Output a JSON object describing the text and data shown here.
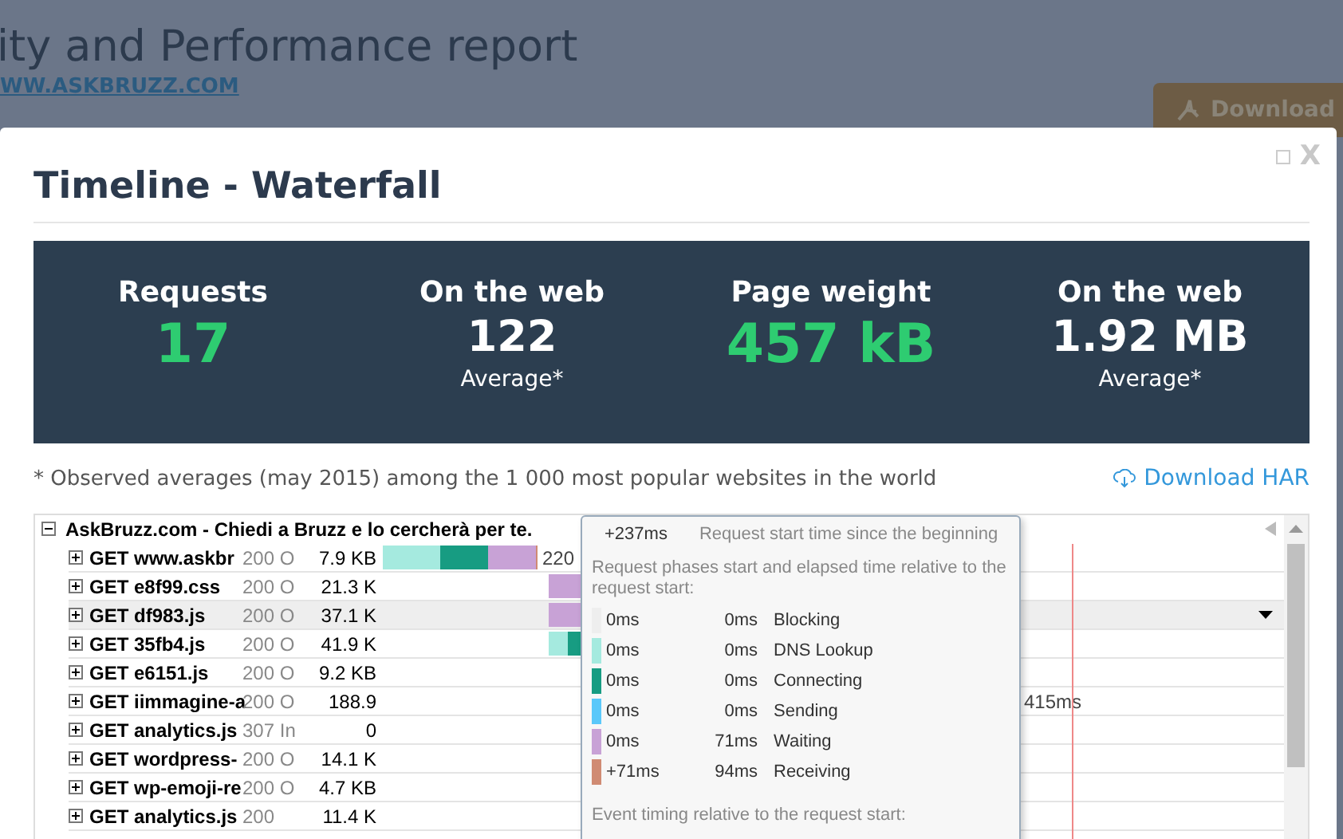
{
  "page": {
    "title": "ity and Performance report",
    "link": "WW.ASKBRUZZ.COM",
    "download_button": "Download"
  },
  "modal": {
    "title": "Timeline - Waterfall",
    "close": "X"
  },
  "stats": [
    {
      "label": "Requests",
      "value": "17",
      "highlight": true
    },
    {
      "label": "On the web",
      "value": "122",
      "note": "Average*",
      "highlight": false
    },
    {
      "label": "Page weight",
      "value": "457 kB",
      "highlight": true
    },
    {
      "label": "On the web",
      "value": "1.92 MB",
      "note": "Average*",
      "highlight": false
    }
  ],
  "footnote": "* Observed averages (may 2015) among the 1 000 most popular websites in the world",
  "download_har": "Download HAR",
  "waterfall": {
    "page": "AskBruzz.com - Chiedi a Bruzz e lo cercherà per te.",
    "expanded": true,
    "rows": [
      {
        "name": "GET www.askbr",
        "status": "200 O",
        "size": "7.9 KB",
        "timing": "220",
        "selected": false
      },
      {
        "name": "GET e8f99.css",
        "status": "200 O",
        "size": "21.3 K",
        "selected": false
      },
      {
        "name": "GET df983.js",
        "status": "200 O",
        "size": "37.1 K",
        "selected": true
      },
      {
        "name": "GET 35fb4.js",
        "status": "200 O",
        "size": "41.9 K",
        "selected": false
      },
      {
        "name": "GET e6151.js",
        "status": "200 O",
        "size": "9.2 KB",
        "selected": false
      },
      {
        "name": "GET iimmagine-a",
        "status": "200 O",
        "size": "188.9",
        "timing": "415ms",
        "selected": false
      },
      {
        "name": "GET analytics.js",
        "status": "307 In",
        "size": "0",
        "selected": false
      },
      {
        "name": "GET wordpress-",
        "status": "200 O",
        "size": "14.1 K",
        "selected": false
      },
      {
        "name": "GET wp-emoji-re",
        "status": "200 O",
        "size": "4.7 KB",
        "selected": false
      },
      {
        "name": "GET analytics.js",
        "status": "200",
        "size": "11.4 K",
        "selected": false
      }
    ]
  },
  "tooltip": {
    "start": "+237ms",
    "start_label": "Request start time since the beginning",
    "phases_heading": "Request phases start and elapsed time relative to the request start:",
    "phases": [
      {
        "start": "0ms",
        "elapsed": "0ms",
        "name": "Blocking",
        "color": "#eeeeee"
      },
      {
        "start": "0ms",
        "elapsed": "0ms",
        "name": "DNS Lookup",
        "color": "#a5eadf"
      },
      {
        "start": "0ms",
        "elapsed": "0ms",
        "name": "Connecting",
        "color": "#179c82"
      },
      {
        "start": "0ms",
        "elapsed": "0ms",
        "name": "Sending",
        "color": "#5ac8fa"
      },
      {
        "start": "0ms",
        "elapsed": "71ms",
        "name": "Waiting",
        "color": "#c8a2d6"
      },
      {
        "start": "+71ms",
        "elapsed": "94ms",
        "name": "Receiving",
        "color": "#d08b73"
      }
    ],
    "events_heading": "Event timing relative to the request start:"
  }
}
